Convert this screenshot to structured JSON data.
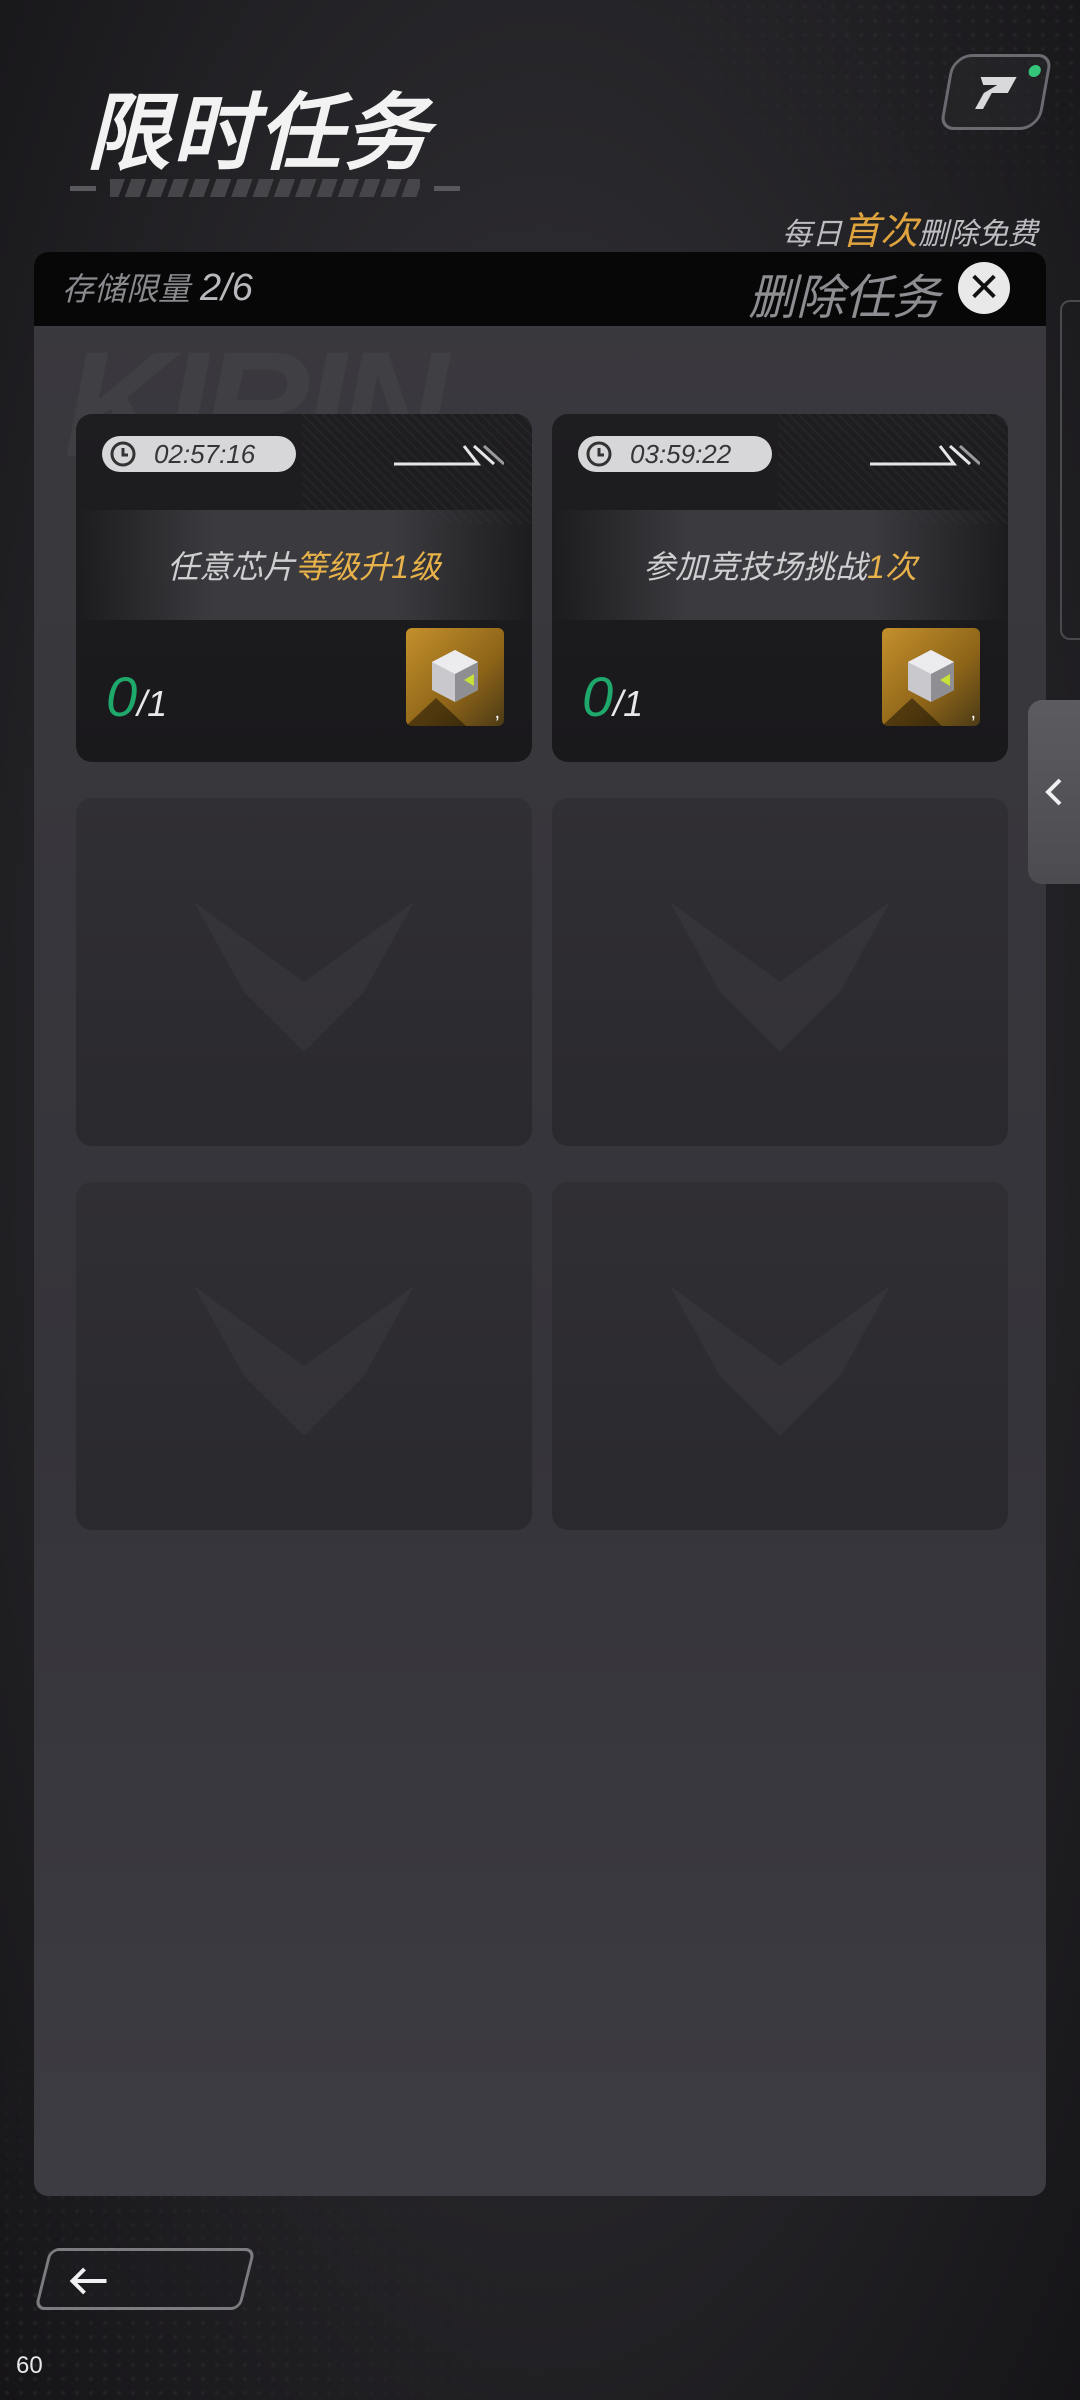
{
  "header": {
    "title": "限时任务",
    "free_note_prefix": "每日",
    "free_note_highlight": "首次",
    "free_note_suffix": "删除免费"
  },
  "panel": {
    "storage_label": "存储限量",
    "storage_count": "2/6",
    "delete_label": "删除任务"
  },
  "tasks": [
    {
      "timer": "02:57:16",
      "desc_plain": "任意芯片",
      "desc_highlight": "等级升1级",
      "progress_current": "0",
      "progress_total": "/1",
      "reward_icon": "chip-cube-icon",
      "reward_count": ","
    },
    {
      "timer": "03:59:22",
      "desc_plain": "参加竞技场挑战",
      "desc_highlight": "1次",
      "progress_current": "0",
      "progress_total": "/1",
      "reward_icon": "chip-cube-icon",
      "reward_count": ","
    }
  ],
  "empty_slots": 4,
  "status": {
    "fps": "60"
  },
  "colors": {
    "accent_gold": "#e8b24a",
    "progress_green": "#1ea86b",
    "indicator_green": "#34c47a"
  }
}
